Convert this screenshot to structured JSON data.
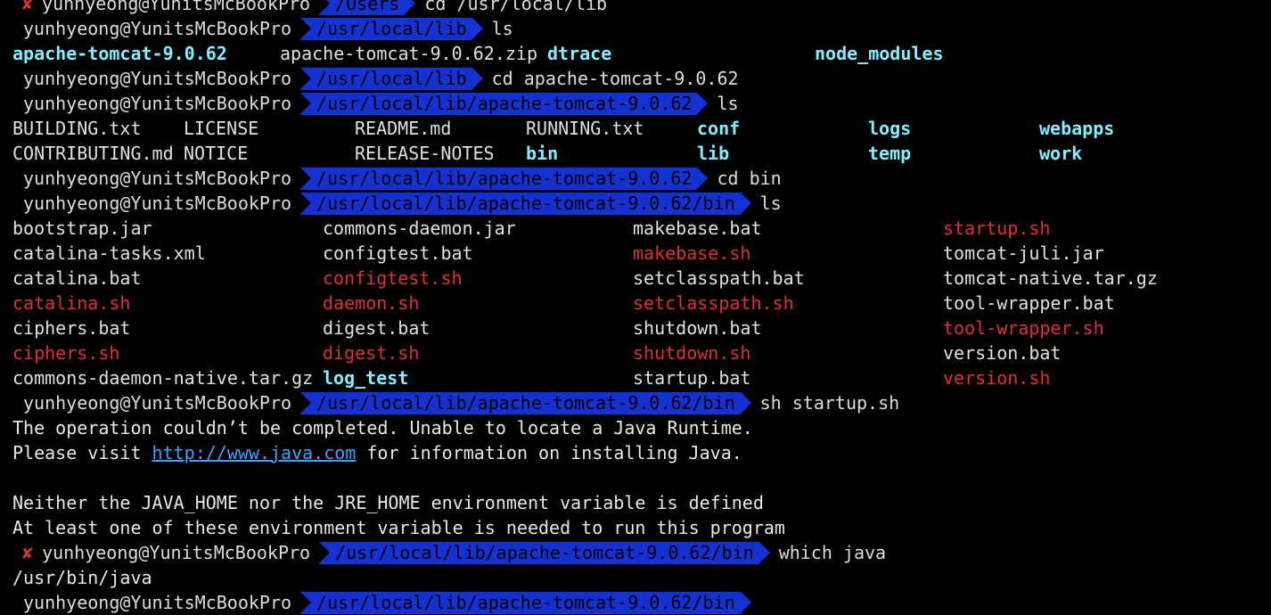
{
  "prompt_user": "yunhyeong@YunitsMcBookPro",
  "error_mark": "✘",
  "commands": {
    "c1": {
      "path": "/Users",
      "cmd": "cd /usr/local/lib"
    },
    "c2": {
      "path": "/usr/local/lib",
      "cmd": "ls"
    },
    "c3": {
      "path": "/usr/local/lib",
      "cmd": "cd apache-tomcat-9.0.62"
    },
    "c4": {
      "path": "/usr/local/lib/apache-tomcat-9.0.62",
      "cmd": "ls"
    },
    "c5": {
      "path": "/usr/local/lib/apache-tomcat-9.0.62",
      "cmd": "cd bin"
    },
    "c6": {
      "path": "/usr/local/lib/apache-tomcat-9.0.62/bin",
      "cmd": "ls"
    },
    "c7": {
      "path": "/usr/local/lib/apache-tomcat-9.0.62/bin",
      "cmd": "sh startup.sh"
    },
    "c8": {
      "path": "/usr/local/lib/apache-tomcat-9.0.62/bin",
      "cmd": "which java"
    }
  },
  "ls_lib": [
    "apache-tomcat-9.0.62",
    "apache-tomcat-9.0.62.zip",
    "dtrace",
    "node_modules"
  ],
  "ls_tomcat": {
    "row1": [
      "BUILDING.txt",
      "LICENSE",
      "README.md",
      "RUNNING.txt",
      "conf",
      "logs",
      "webapps"
    ],
    "row2": [
      "CONTRIBUTING.md",
      "NOTICE",
      "RELEASE-NOTES",
      "bin",
      "lib",
      "temp",
      "work"
    ]
  },
  "ls_bin": {
    "col1": [
      "bootstrap.jar",
      "catalina-tasks.xml",
      "catalina.bat",
      "catalina.sh",
      "ciphers.bat",
      "ciphers.sh",
      "commons-daemon-native.tar.gz"
    ],
    "col2": [
      "commons-daemon.jar",
      "configtest.bat",
      "configtest.sh",
      "daemon.sh",
      "digest.bat",
      "digest.sh",
      "log_test"
    ],
    "col3": [
      "makebase.bat",
      "makebase.sh",
      "setclasspath.bat",
      "setclasspath.sh",
      "shutdown.bat",
      "shutdown.sh",
      "startup.bat"
    ],
    "col4": [
      "startup.sh",
      "tomcat-juli.jar",
      "tomcat-native.tar.gz",
      "tool-wrapper.bat",
      "tool-wrapper.sh",
      "version.bat",
      "version.sh"
    ]
  },
  "output": {
    "o1a": "The operation couldn’t be completed. Unable to locate a Java Runtime.",
    "o1b_pre": "Please visit ",
    "o1b_link": "http://www.java.com",
    "o1b_post": " for information on installing Java.",
    "o2": "Neither the JAVA_HOME nor the JRE_HOME environment variable is defined",
    "o3": "At least one of these environment variable is needed to run this program",
    "o4": "/usr/bin/java"
  },
  "colors": {
    "background": "#000000",
    "path_segment": "#1432d2",
    "directory": "#7ef0ff",
    "executable": "#e0312b",
    "link": "#3aa3ff"
  }
}
